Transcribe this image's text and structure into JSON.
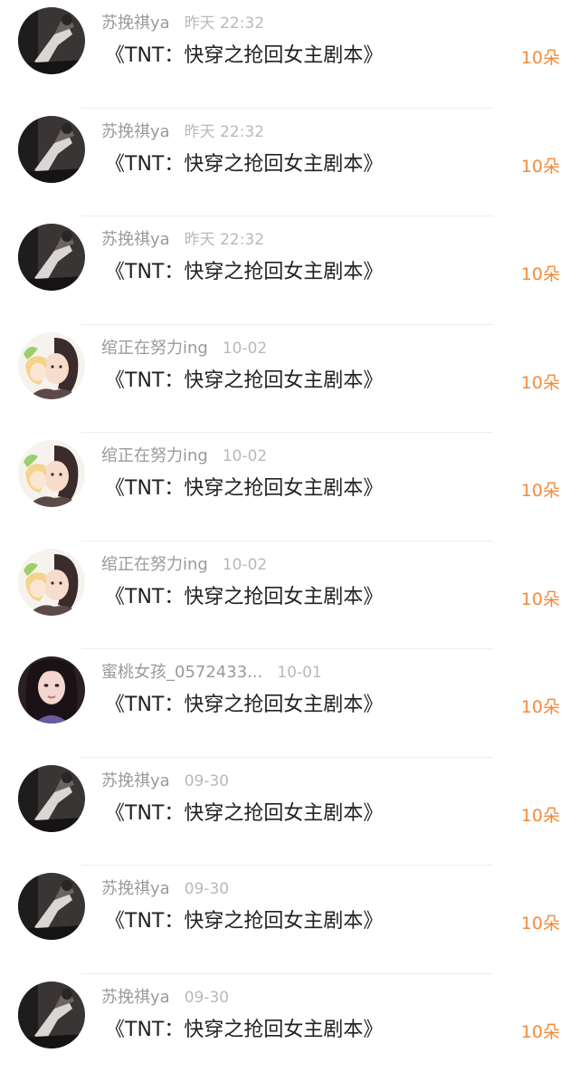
{
  "colors": {
    "amount": "#f58a3a"
  },
  "records": [
    {
      "user": "苏挽祺ya",
      "time": "昨天 22:32",
      "title": "《TNT：快穿之抢回女主剧本》",
      "amount": "10朵",
      "avatar": "dark-photo-avatar"
    },
    {
      "user": "苏挽祺ya",
      "time": "昨天 22:32",
      "title": "《TNT：快穿之抢回女主剧本》",
      "amount": "10朵",
      "avatar": "dark-photo-avatar"
    },
    {
      "user": "苏挽祺ya",
      "time": "昨天 22:32",
      "title": "《TNT：快穿之抢回女主剧本》",
      "amount": "10朵",
      "avatar": "dark-photo-avatar"
    },
    {
      "user": "绾正在努力ing",
      "time": "10-02",
      "title": "《TNT：快穿之抢回女主剧本》",
      "amount": "10朵",
      "avatar": "illustrated-avatar"
    },
    {
      "user": "绾正在努力ing",
      "time": "10-02",
      "title": "《TNT：快穿之抢回女主剧本》",
      "amount": "10朵",
      "avatar": "illustrated-avatar"
    },
    {
      "user": "绾正在努力ing",
      "time": "10-02",
      "title": "《TNT：快穿之抢回女主剧本》",
      "amount": "10朵",
      "avatar": "illustrated-avatar"
    },
    {
      "user": "蜜桃女孩_0572433...",
      "time": "10-01",
      "title": "《TNT：快穿之抢回女主剧本》",
      "amount": "10朵",
      "avatar": "portrait-avatar"
    },
    {
      "user": "苏挽祺ya",
      "time": "09-30",
      "title": "《TNT：快穿之抢回女主剧本》",
      "amount": "10朵",
      "avatar": "dark-photo-avatar"
    },
    {
      "user": "苏挽祺ya",
      "time": "09-30",
      "title": "《TNT：快穿之抢回女主剧本》",
      "amount": "10朵",
      "avatar": "dark-photo-avatar"
    },
    {
      "user": "苏挽祺ya",
      "time": "09-30",
      "title": "《TNT：快穿之抢回女主剧本》",
      "amount": "10朵",
      "avatar": "dark-photo-avatar"
    }
  ]
}
